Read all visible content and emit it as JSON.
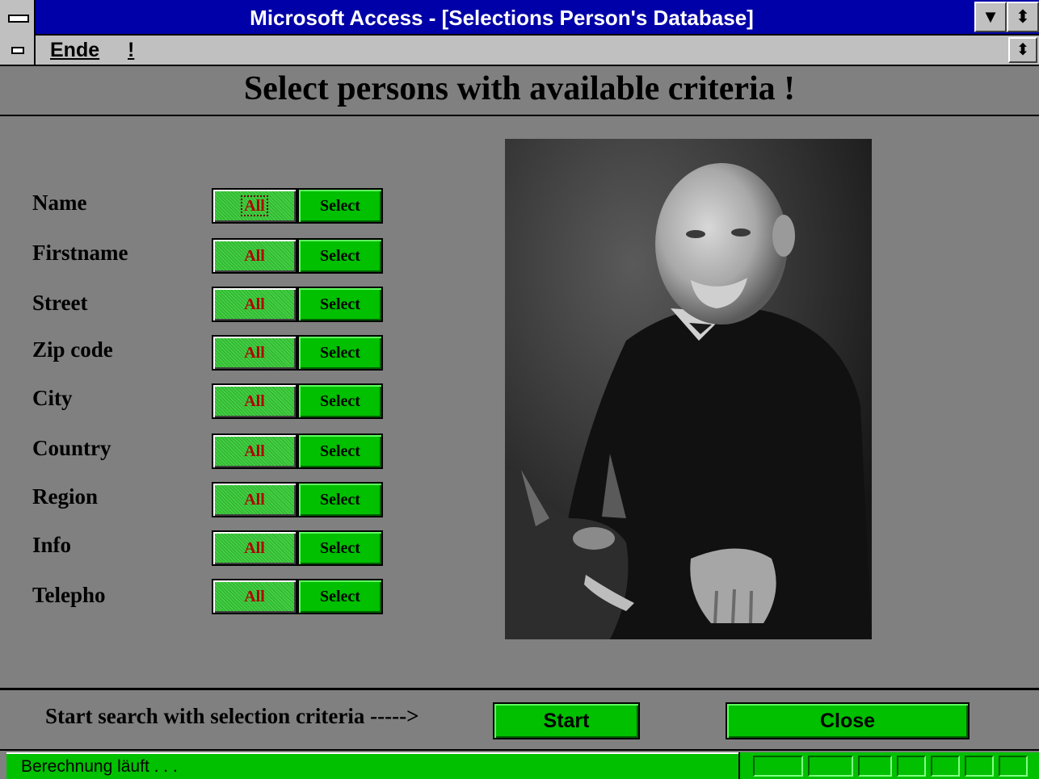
{
  "window": {
    "title": "Microsoft Access - [Selections Person's Database]"
  },
  "menu": {
    "items": [
      {
        "label": "Ende"
      },
      {
        "label": "!"
      }
    ]
  },
  "form": {
    "heading": "Select persons with available criteria !",
    "all_label": "All",
    "select_label": "Select",
    "criteria": [
      {
        "label": "Name"
      },
      {
        "label": "Firstname"
      },
      {
        "label": "Street"
      },
      {
        "label": "Zip code"
      },
      {
        "label": "City"
      },
      {
        "label": "Country"
      },
      {
        "label": "Region"
      },
      {
        "label": "Info"
      },
      {
        "label": "Telepho"
      }
    ],
    "hint": "Start search with selection criteria ----->",
    "start_label": "Start",
    "close_label": "Close"
  },
  "status": {
    "text": "Berechnung läuft . . ."
  },
  "colors": {
    "title_bar": "#0000a8",
    "accent_green": "#00c000",
    "all_text": "#b00000"
  },
  "icons": {
    "system_menu": "system-menu-icon",
    "minimize": "arrow-down-icon",
    "restore": "restore-icon"
  }
}
